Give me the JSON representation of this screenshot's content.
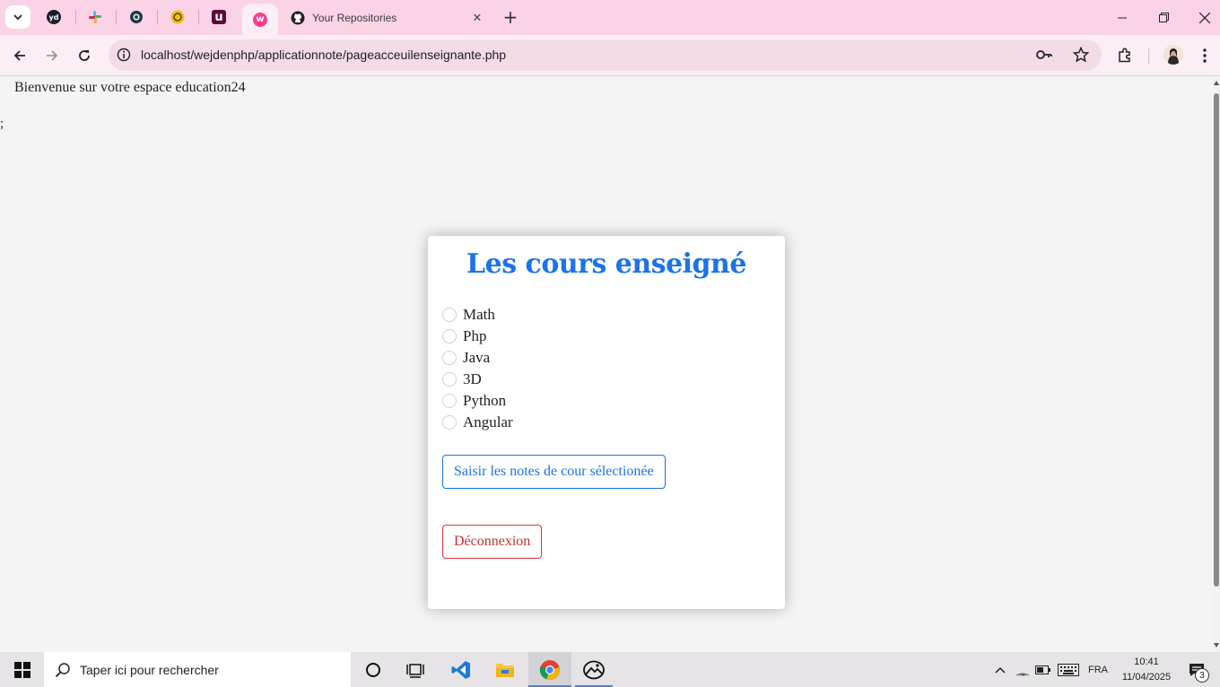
{
  "browser": {
    "pinned_tabs": [
      {
        "name": "yd-tab",
        "label": "yd"
      },
      {
        "name": "slack-tab",
        "label": ""
      },
      {
        "name": "circle-tab",
        "label": ""
      },
      {
        "name": "yellow-tab",
        "label": ""
      },
      {
        "name": "udemy-tab",
        "label": "u"
      }
    ],
    "active_tab_icon": "w",
    "main_tab_title": "Your Repositories",
    "url": "localhost/wejdenphp/applicationnote/pageacceuilenseignante.php",
    "accent_color": "#fbd3e7"
  },
  "page": {
    "welcome_text": "Bienvenue sur votre espace education24",
    "stray_text": ";",
    "card": {
      "title": "Les cours enseigné",
      "courses": [
        "Math",
        "Php",
        "Java",
        "3D",
        "Python",
        "Angular"
      ],
      "notes_button_label": "Saisir les notes de cour sélectionée",
      "logout_button_label": "Déconnexion",
      "title_color": "#1a73e8",
      "logout_color": "#c9302c"
    }
  },
  "taskbar": {
    "search_placeholder": "Taper ici pour rechercher",
    "language": "FRA",
    "time": "10:41",
    "date": "11/04/2025",
    "notifications": "3"
  }
}
